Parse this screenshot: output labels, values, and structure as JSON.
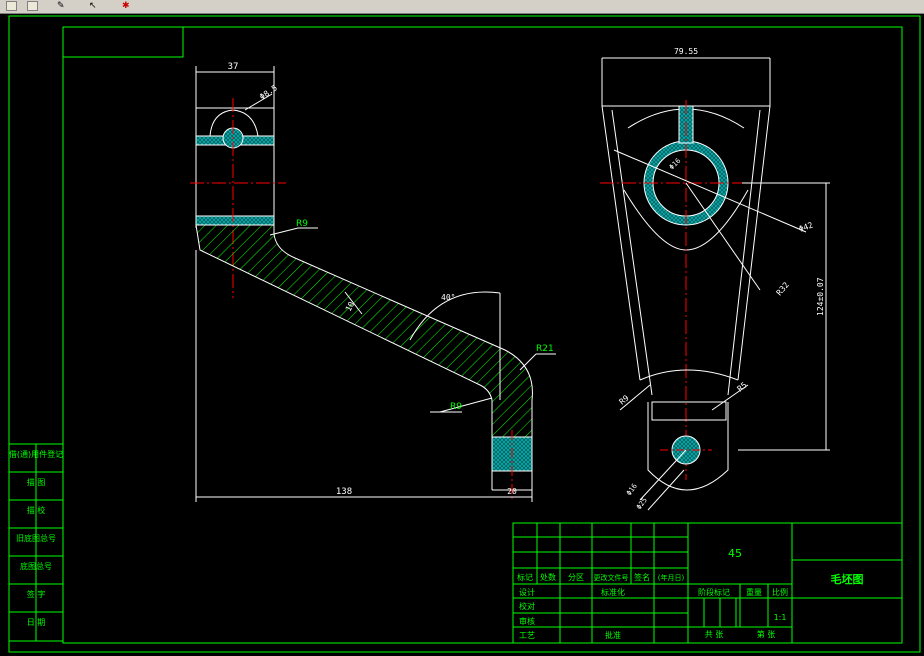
{
  "colors": {
    "background": "#000000",
    "border": "#00ff00",
    "outline": "#ffffff",
    "center_line": "#ff0000",
    "hatch": "#00ff00",
    "section_fill": "#00c8c8",
    "annotation": "#00ff00",
    "text": "#00ff00"
  },
  "toolbar": {
    "icons": [
      "zoom-window-icon",
      "zoom-previous-icon",
      "properties-icon",
      "cursor-icon",
      "paint-icon"
    ]
  },
  "dimensions": {
    "top_width": "37",
    "top_hole": "Φ8.5",
    "fillet_upper": "R9",
    "fillet_lower": "R9",
    "outer_radius": "R21",
    "rib_width": "10",
    "angle": "40°",
    "overall_length": "138",
    "foot_width": "20",
    "right_top_width": "79.55",
    "bore": "Φ16",
    "boss_dia": "Φ42",
    "arc_radius": "R32",
    "center_distance": "124±0.07",
    "small_radius": "R9",
    "slot_radius": "R5",
    "small_bore": "Φ16",
    "outer_boss": "Φ25"
  },
  "title_block": {
    "material": "45",
    "drawing_title": "毛坯图",
    "rows_header": [
      "标记",
      "处数",
      "分区",
      "更改文件号",
      "签名",
      "(年月日)"
    ],
    "design": "设计",
    "standardization": "标准化",
    "check": "校对",
    "review": "审核",
    "process": "工艺",
    "approve": "批准",
    "stage_mark": "阶段标记",
    "weight": "重量",
    "scale_label": "比例",
    "scale_value": "1:1",
    "total_sheets": "共 张",
    "sheet_no": "第 张"
  },
  "left_block": {
    "labels": [
      "借(通)用件登记",
      "描 图",
      "描 校",
      "旧底图总号",
      "底图总号",
      "签 字",
      "日 期"
    ]
  }
}
